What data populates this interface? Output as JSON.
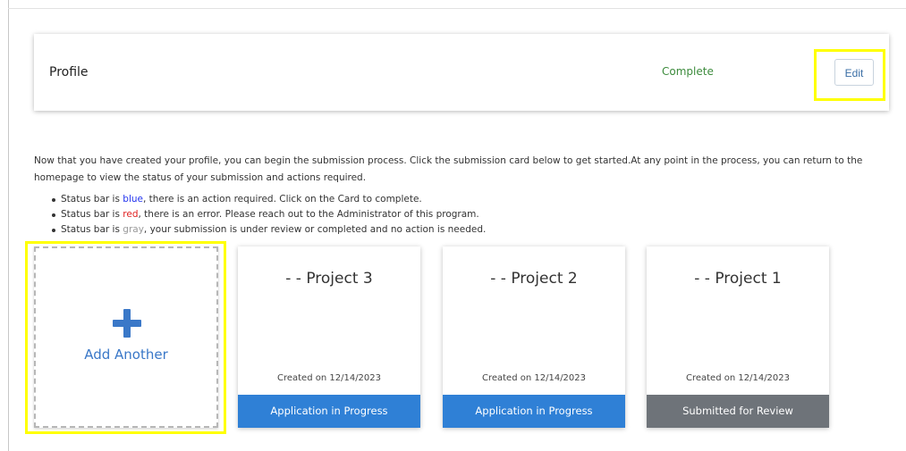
{
  "profile": {
    "title": "Profile",
    "status": "Complete",
    "edit_label": "Edit"
  },
  "intro": {
    "text": "Now that you have created your profile, you can begin the submission process. Click the submission card below to get started.At any point in the process, you can return to the homepage to view the status of your submission and actions required."
  },
  "bullets": [
    {
      "prefix": "Status bar is ",
      "color_word": "blue",
      "color": "#2233ee",
      "suffix": ", there is an action required. Click on the Card to complete."
    },
    {
      "prefix": "Status bar is ",
      "color_word": "red",
      "color": "#e02020",
      "suffix": ", there is an error. Please reach out to the Administrator of this program."
    },
    {
      "prefix": "Status bar is ",
      "color_word": "gray",
      "color": "#9a9a9a",
      "suffix": ", your submission is under review or completed and no action is needed."
    }
  ],
  "add_card": {
    "icon": "plus-icon",
    "label": "Add Another"
  },
  "projects": [
    {
      "title": "- - Project 3",
      "created": "Created on 12/14/2023",
      "status": "Application in Progress",
      "status_color": "#2f80d6"
    },
    {
      "title": "- - Project 2",
      "created": "Created on 12/14/2023",
      "status": "Application in Progress",
      "status_color": "#2f80d6"
    },
    {
      "title": "- - Project 1",
      "created": "Created on 12/14/2023",
      "status": "Submitted for Review",
      "status_color": "#6e7379"
    }
  ]
}
